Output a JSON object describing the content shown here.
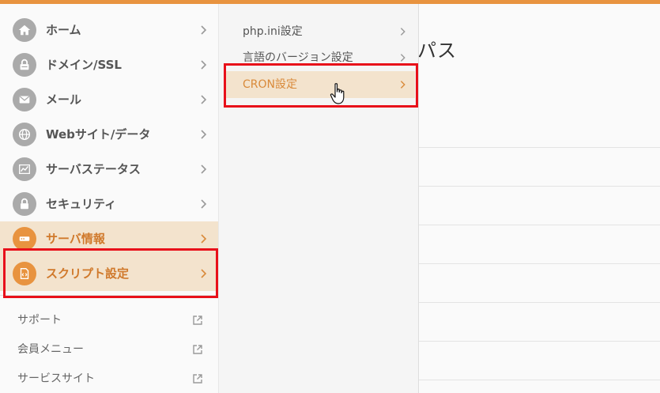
{
  "nav": {
    "items": [
      {
        "label": "ホーム",
        "icon": "home-icon"
      },
      {
        "label": "ドメイン/SSL",
        "icon": "lock-icon"
      },
      {
        "label": "メール",
        "icon": "mail-icon"
      },
      {
        "label": "Webサイト/データ",
        "icon": "globe-icon"
      },
      {
        "label": "サーバステータス",
        "icon": "chart-icon"
      },
      {
        "label": "セキュリティ",
        "icon": "padlock-icon"
      },
      {
        "label": "サーバ情報",
        "icon": "server-icon"
      },
      {
        "label": "スクリプト設定",
        "icon": "script-file-icon"
      }
    ],
    "links": [
      {
        "label": "サポート",
        "icon": "external-link-icon"
      },
      {
        "label": "会員メニュー",
        "icon": "external-link-icon"
      },
      {
        "label": "サービスサイト",
        "icon": "external-link-icon"
      }
    ]
  },
  "submenu": {
    "items": [
      {
        "label": "php.ini設定"
      },
      {
        "label": "言語のバージョン設定"
      },
      {
        "label": "CRON設定"
      }
    ]
  },
  "main": {
    "title_fragment": "パス"
  },
  "colors": {
    "accent": "#e8933f",
    "active_bg": "#f3e3cd",
    "highlight": "#e8101a"
  }
}
